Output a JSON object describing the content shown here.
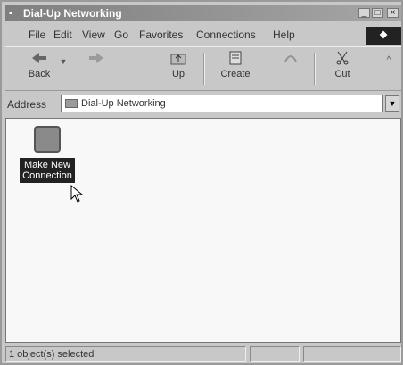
{
  "window": {
    "title": "Dial-Up Networking"
  },
  "menu": [
    "File",
    "Edit",
    "View",
    "Go",
    "Favorites",
    "Connections",
    "Help"
  ],
  "toolbar": {
    "back": "Back",
    "up": "Up",
    "create": "Create",
    "cut": "Cut"
  },
  "address": {
    "label": "Address",
    "value": "Dial-Up Networking"
  },
  "items": [
    {
      "line1": "Make New",
      "line2": "Connection"
    }
  ],
  "status": {
    "text": "1 object(s) selected"
  }
}
